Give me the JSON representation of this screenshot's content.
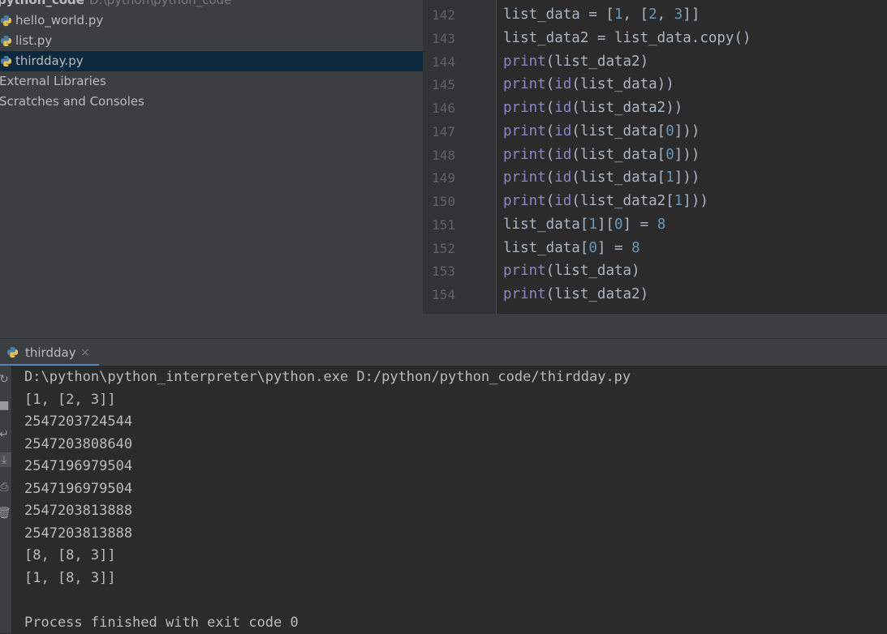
{
  "project": {
    "root_name": "python_code",
    "root_path": "D:\\python\\python_code",
    "files": [
      {
        "name": "hello_world.py",
        "selected": false
      },
      {
        "name": "list.py",
        "selected": false
      },
      {
        "name": "thirdday.py",
        "selected": true
      }
    ],
    "external_libraries": "External Libraries",
    "scratches": "Scratches and Consoles"
  },
  "editor": {
    "line_numbers": [
      "142",
      "143",
      "144",
      "145",
      "146",
      "147",
      "148",
      "149",
      "150",
      "151",
      "152",
      "153",
      "154"
    ],
    "lines": [
      "list_data = [1, [2, 3]]",
      "list_data2 = list_data.copy()",
      "print(list_data2)",
      "print(id(list_data))",
      "print(id(list_data2))",
      "print(id(list_data[0]))",
      "print(id(list_data[0]))",
      "print(id(list_data[1]))",
      "print(id(list_data2[1]))",
      "list_data[1][0] = 8",
      "list_data[0] = 8",
      "print(list_data)",
      "print(list_data2)"
    ]
  },
  "run": {
    "tab_label": "thirdday",
    "tab_close": "×",
    "output": [
      "D:\\python\\python_interpreter\\python.exe D:/python/python_code/thirdday.py",
      "[1, [2, 3]]",
      "2547203724544",
      "2547203808640",
      "2547196979504",
      "2547196979504",
      "2547203813888",
      "2547203813888",
      "[8, [8, 3]]",
      "[1, [8, 3]]",
      "",
      "Process finished with exit code 0"
    ]
  },
  "colors": {
    "keyword": "#8888c6",
    "number": "#6897bb",
    "text": "#a9b7c6",
    "selection": "#0d293e"
  }
}
